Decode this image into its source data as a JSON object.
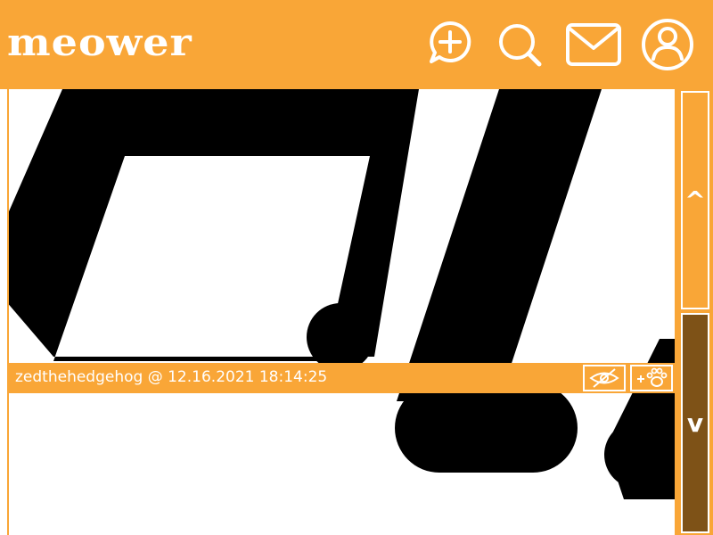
{
  "app": {
    "logo_text": "meower",
    "accent_color": "#f9a637",
    "scroll_down_color": "#7e5217"
  },
  "nav": {
    "icons": [
      "new-post-icon",
      "search-icon",
      "mail-icon",
      "profile-icon"
    ]
  },
  "post": {
    "meta": "zedthehedgehog @ 12.16.2021 18:14:25",
    "buttons": [
      "hide-icon",
      "paw-add-icon"
    ]
  },
  "scroll": {
    "up_label": "^",
    "down_label": "v"
  }
}
